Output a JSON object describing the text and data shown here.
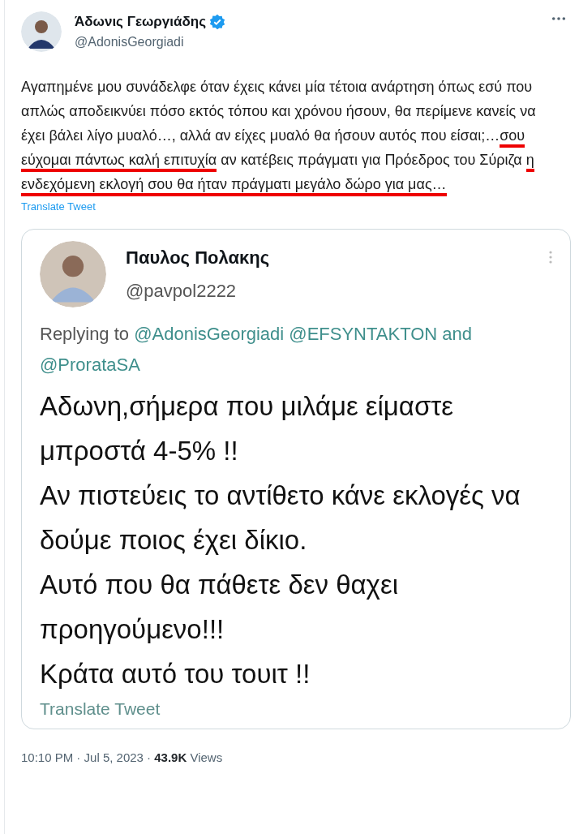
{
  "tweet": {
    "author": {
      "name": "Άδωνις Γεωργιάδης",
      "verified": true,
      "handle": "@AdonisGeorgiadi"
    },
    "text_segments": [
      {
        "text": "Αγαπημένε μου συνάδελφε όταν έχεις κάνει μία τέτοια ανάρτηση όπως εσύ που απλώς αποδεικνύει πόσο εκτός τόπου και χρόνου ήσουν, θα περίμενε κανείς να έχει βάλει λίγο μυαλό…, αλλά αν είχες μυαλό θα ήσουν αυτός που είσαι;…",
        "underlined": false
      },
      {
        "text": "σου εύχομαι πάντως καλή επιτυχία",
        "underlined": true
      },
      {
        "text": " αν κατέβεις πράγματι για Πρόεδρος του Σύριζα ",
        "underlined": false
      },
      {
        "text": "η ενδεχόμενη εκλογή σου θα ήταν πράγματι μεγάλο δώρο για μας…",
        "underlined": true
      }
    ],
    "translate_link": "Translate Tweet",
    "quoted": {
      "name": "Παυλος Πολακης",
      "handle": "@pavpol2222",
      "reply_prefix": "Replying to",
      "reply_mentions": [
        {
          "text": "@AdonisGeorgiadi"
        },
        {
          "text": "@EFSYNTAKTON"
        },
        {
          "text": "and"
        },
        {
          "text": "@ProrataSA"
        }
      ],
      "text": "Αδωνη,σήμερα που μιλάμε είμαστε μπροστά 4-5% !!\nΑν πιστεύεις το αντίθετο κάνε εκλογές να δούμε ποιος έχει δίκιο.\nΑυτό που θα πάθετε δεν θαχει προηγούμενο!!!\nΚράτα αυτό του τουιτ !!",
      "translate_link": "Translate Tweet"
    },
    "time": "10:10 PM",
    "separator_1": "·",
    "date": "Jul 5, 2023",
    "separator_2": "·",
    "views_count": "43.9K",
    "views_label": "Views"
  }
}
